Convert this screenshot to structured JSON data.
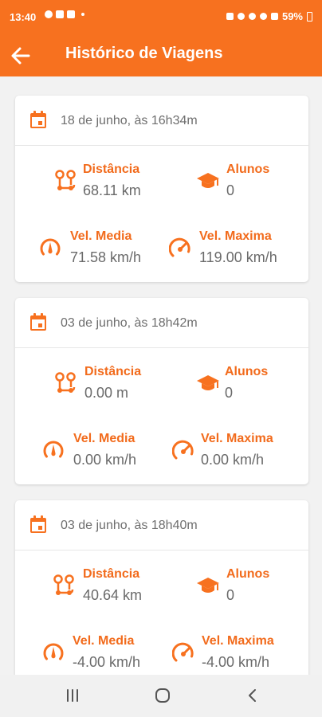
{
  "status_bar": {
    "time": "13:40",
    "battery": "59%"
  },
  "app_bar": {
    "title": "Histórico de Viagens"
  },
  "colors": {
    "primary": "#f7711f",
    "accent_text": "#f26b1c",
    "value_text": "#6a6a6a",
    "date_text": "#6e6e6e"
  },
  "labels": {
    "distance": "Distância",
    "students": "Alunos",
    "avg_speed": "Vel. Media",
    "max_speed": "Vel. Maxima"
  },
  "icons": {
    "back": "arrow-left-icon",
    "date": "calendar-icon",
    "distance": "route-icon",
    "students": "graduation-cap-icon",
    "avg_speed": "speedometer-icon",
    "max_speed": "gauge-icon"
  },
  "trips": [
    {
      "date": "18 de junho, às 16h34m",
      "distance": "68.11 km",
      "students": "0",
      "avg_speed": "71.58 km/h",
      "max_speed": "119.00 km/h"
    },
    {
      "date": "03 de junho, às 18h42m",
      "distance": "0.00 m",
      "students": "0",
      "avg_speed": "0.00 km/h",
      "max_speed": "0.00 km/h"
    },
    {
      "date": "03 de junho, às 18h40m",
      "distance": "40.64 km",
      "students": "0",
      "avg_speed": "-4.00 km/h",
      "max_speed": "-4.00 km/h"
    }
  ]
}
